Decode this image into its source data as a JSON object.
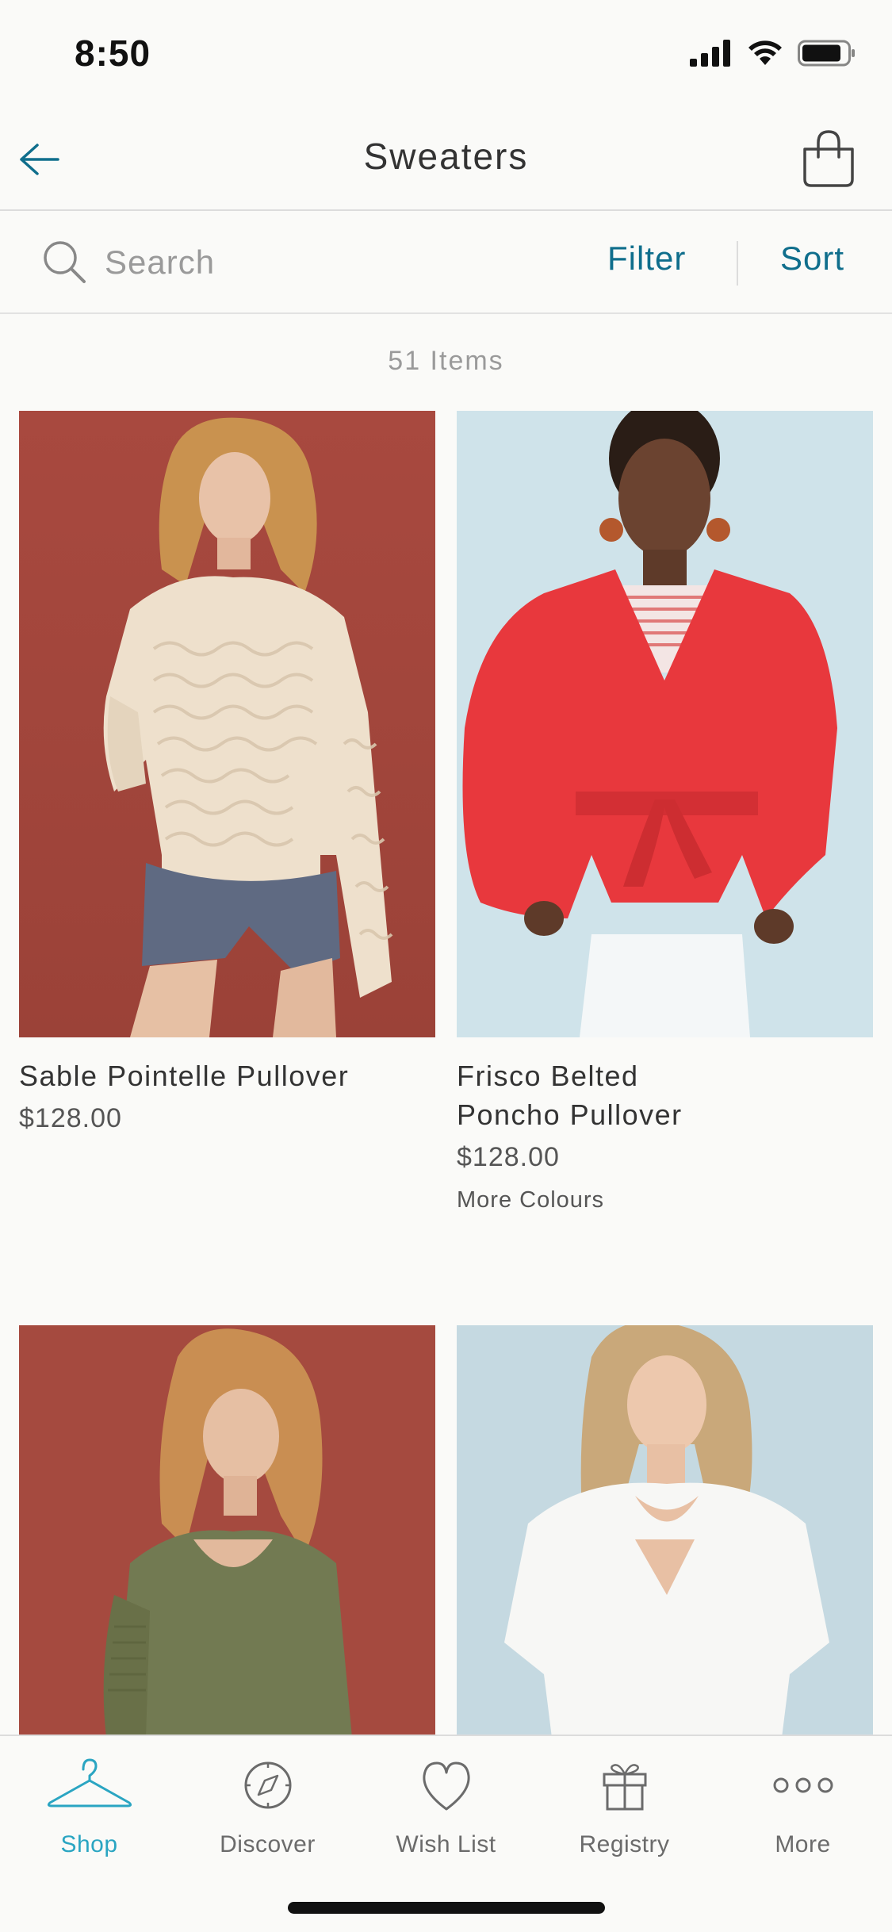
{
  "status_bar": {
    "time": "8:50",
    "icons": [
      "signal-icon",
      "wifi-icon",
      "battery-icon"
    ]
  },
  "header": {
    "title": "Sweaters",
    "back_icon": "arrow-left-icon",
    "bag_icon": "shopping-bag-icon"
  },
  "search": {
    "placeholder": "Search",
    "filter_label": "Filter",
    "sort_label": "Sort"
  },
  "results": {
    "count_label": "51 Items"
  },
  "products": [
    {
      "name": "Sable Pointelle Pullover",
      "price": "$128.00",
      "extra": ""
    },
    {
      "name": "Frisco Belted Poncho Pullover",
      "price": "$128.00",
      "extra": "More Colours"
    },
    {
      "name": "",
      "price": "",
      "extra": ""
    },
    {
      "name": "",
      "price": "",
      "extra": ""
    }
  ],
  "tab_bar": {
    "tabs": [
      {
        "label": "Shop",
        "icon": "hanger-icon",
        "active": true
      },
      {
        "label": "Discover",
        "icon": "compass-icon",
        "active": false
      },
      {
        "label": "Wish List",
        "icon": "heart-icon",
        "active": false
      },
      {
        "label": "Registry",
        "icon": "gift-icon",
        "active": false
      },
      {
        "label": "More",
        "icon": "more-dots-icon",
        "active": false
      }
    ]
  },
  "colors": {
    "accent": "#0f6e8c",
    "active_tab": "#2aa5c2",
    "background": "#fafaf8"
  }
}
